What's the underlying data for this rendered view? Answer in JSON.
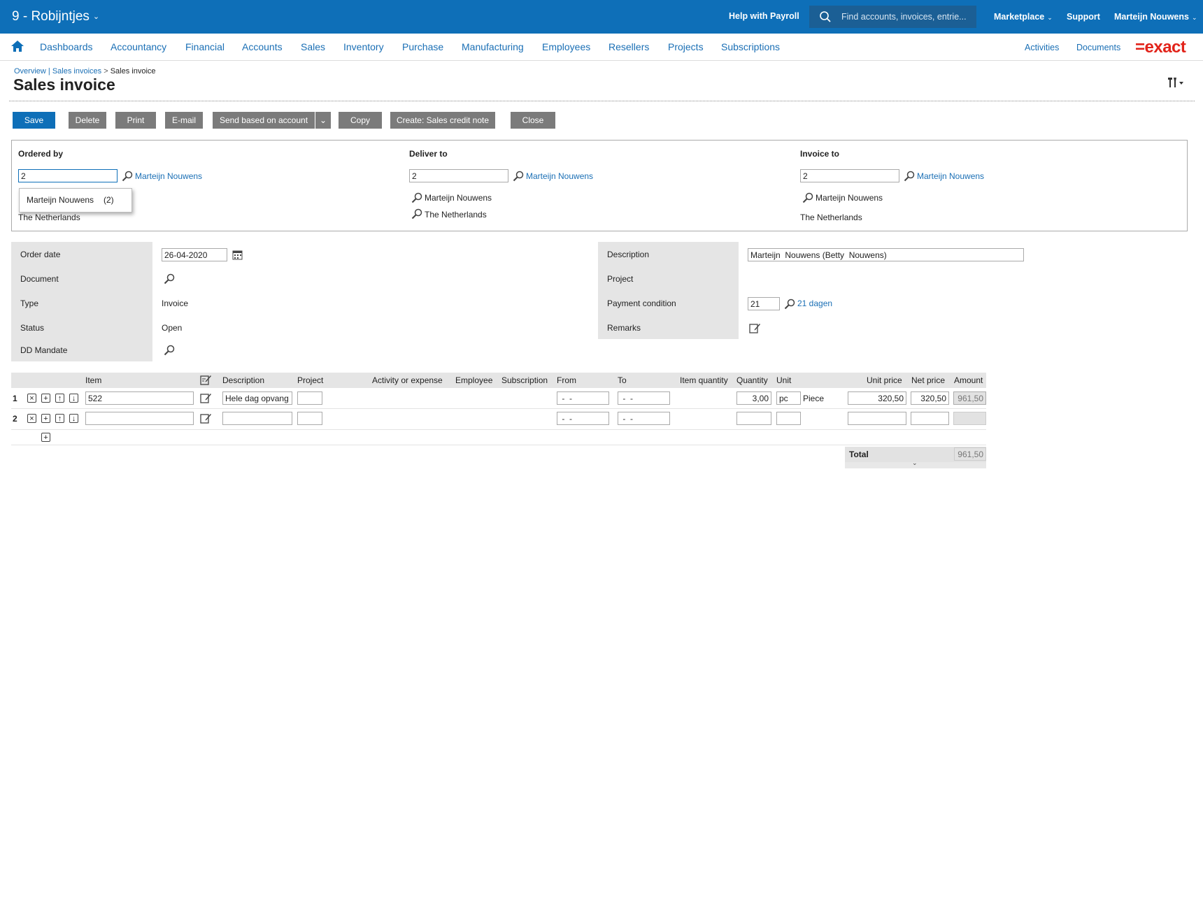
{
  "topbar": {
    "company": "9 - Robijntjes",
    "help": "Help with Payroll",
    "search_placeholder": "Find accounts, invoices, entrie...",
    "marketplace": "Marketplace",
    "support": "Support",
    "user": "Marteijn Nouwens"
  },
  "nav": {
    "items": [
      "Dashboards",
      "Accountancy",
      "Financial",
      "Accounts",
      "Sales",
      "Inventory",
      "Purchase",
      "Manufacturing",
      "Employees",
      "Resellers",
      "Projects",
      "Subscriptions"
    ],
    "right": [
      "Activities",
      "Documents"
    ],
    "logo": "=exact"
  },
  "breadcrumb": {
    "overview": "Overview",
    "sep1": "|",
    "sales_invoices": "Sales invoices",
    "sep2": ">",
    "current": "Sales invoice"
  },
  "page_title": "Sales invoice",
  "toolbar": {
    "save": "Save",
    "delete": "Delete",
    "print": "Print",
    "email": "E-mail",
    "send": "Send based on account",
    "copy": "Copy",
    "credit": "Create: Sales credit note",
    "close": "Close"
  },
  "ordered_by": {
    "heading": "Ordered by",
    "code": "2",
    "name": "Marteijn Nouwens",
    "country": "The Netherlands",
    "suggestion_name": "Marteijn Nouwens",
    "suggestion_code": "(2)"
  },
  "deliver_to": {
    "heading": "Deliver to",
    "code": "2",
    "name": "Marteijn Nouwens",
    "contact": "Marteijn Nouwens",
    "country": "The Netherlands"
  },
  "invoice_to": {
    "heading": "Invoice to",
    "code": "2",
    "name": "Marteijn Nouwens",
    "contact": "Marteijn Nouwens",
    "country": "The Netherlands"
  },
  "details": {
    "order_date_label": "Order date",
    "order_date": "26-04-2020",
    "document_label": "Document",
    "type_label": "Type",
    "type": "Invoice",
    "status_label": "Status",
    "status": "Open",
    "dd_label": "DD Mandate",
    "description_label": "Description",
    "description": "Marteijn  Nouwens (Betty  Nouwens)",
    "project_label": "Project",
    "payment_label": "Payment condition",
    "payment_code": "21",
    "payment_name": "21 dagen",
    "remarks_label": "Remarks"
  },
  "lines": {
    "headers": {
      "item": "Item",
      "description": "Description",
      "project": "Project",
      "activity": "Activity or expense",
      "employee": "Employee",
      "subscription": "Subscription",
      "from": "From",
      "to": "To",
      "item_quantity": "Item quantity",
      "quantity": "Quantity",
      "unit": "Unit",
      "unit_price": "Unit price",
      "net_price": "Net price",
      "amount": "Amount"
    },
    "rows": [
      {
        "num": "1",
        "item": "522",
        "description": "Hele dag opvang",
        "project": "",
        "from": " -  - ",
        "to": " -  - ",
        "quantity": "3,00",
        "unit": "pc",
        "unit_name": "Piece",
        "unit_price": "320,50",
        "net_price": "320,50",
        "amount": "961,50"
      },
      {
        "num": "2",
        "item": "",
        "description": "",
        "project": "",
        "from": " -  - ",
        "to": " -  - ",
        "quantity": "",
        "unit": "",
        "unit_name": "",
        "unit_price": "",
        "net_price": "",
        "amount": ""
      }
    ],
    "total_label": "Total",
    "total": "961,50"
  }
}
